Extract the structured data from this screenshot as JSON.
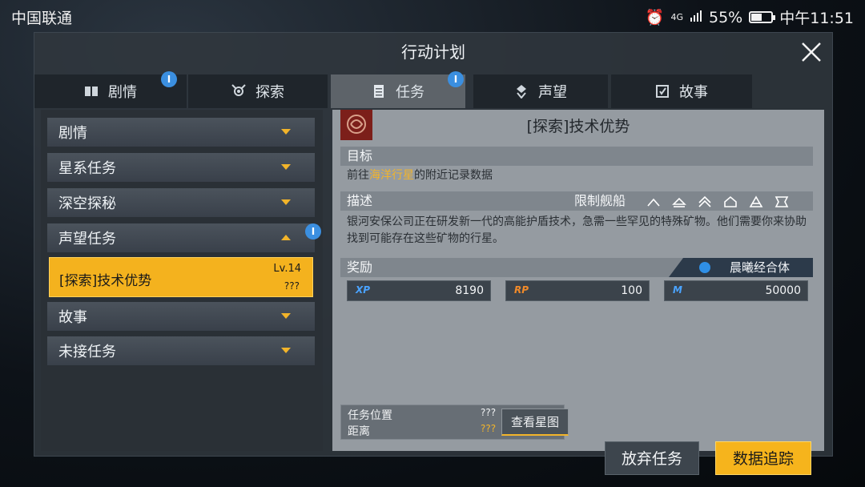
{
  "status_bar": {
    "carrier": "中国联通",
    "network": "4G",
    "battery": "55%",
    "battery_level": 0.55,
    "time": "中午11:51"
  },
  "window": {
    "title": "行动计划"
  },
  "tabs": [
    {
      "label": "剧情",
      "icon": "book-icon",
      "badge": "I"
    },
    {
      "label": "探索",
      "icon": "explore-icon"
    },
    {
      "label": "任务",
      "icon": "mission-icon",
      "badge": "I",
      "active": true
    },
    {
      "label": "声望",
      "icon": "reputation-icon"
    },
    {
      "label": "故事",
      "icon": "story-icon"
    }
  ],
  "categories": [
    {
      "label": "剧情"
    },
    {
      "label": "星系任务"
    },
    {
      "label": "深空探秘"
    },
    {
      "label": "声望任务",
      "expanded": true,
      "badge": "I"
    },
    {
      "label": "故事"
    },
    {
      "label": "未接任务"
    }
  ],
  "selected_quest": {
    "name": "[探索]技术优势",
    "level": "Lv.14",
    "unknown": "???"
  },
  "detail": {
    "title": "[探索]技术优势",
    "objective_header": "目标",
    "objective_prefix": "前往",
    "objective_highlight": "海洋行星",
    "objective_suffix": "的附近记录数据",
    "description_header": "描述",
    "ship_restriction_label": "限制舰船",
    "description": "银河安保公司正在研发新一代的高能护盾技术，急需一些罕见的特殊矿物。他们需要你来协助找到可能存在这些矿物的行星。",
    "reward_header": "奖励",
    "reward_faction": "晨曦经合体",
    "rewards": [
      {
        "key": "XP",
        "value": "8190"
      },
      {
        "key": "RP",
        "value": "100"
      },
      {
        "key": "M",
        "value": "50000"
      }
    ],
    "location_label": "任务位置",
    "distance_label": "距离",
    "location_value": "???",
    "distance_value": "???",
    "starmap_button": "查看星图",
    "abandon_button": "放弃任务",
    "track_button": "数据追踪"
  },
  "colors": {
    "accent": "#f4b21e",
    "badge": "#3b8fe0",
    "highlight_text": "#f2b42a"
  }
}
